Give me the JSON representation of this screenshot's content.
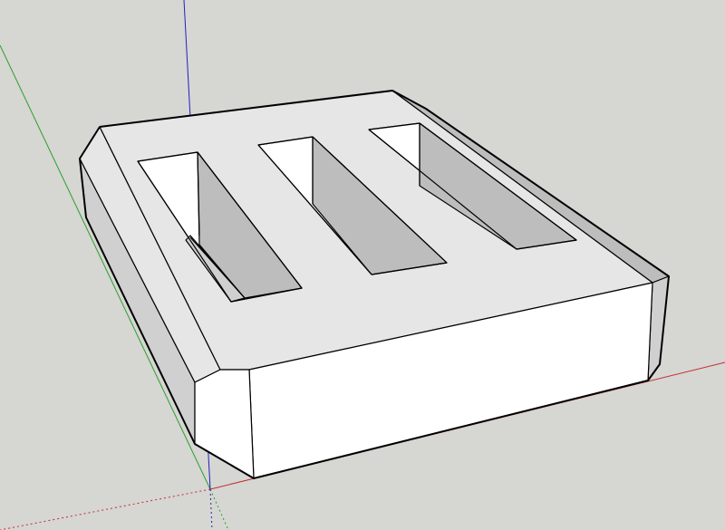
{
  "app": {
    "tool": "3d-modeling-viewport"
  },
  "scene": {
    "background_color": "#d6d6d3",
    "axes": {
      "x_axis_color": "#c03030",
      "y_axis_color": "#2aa02a",
      "z_axis_color": "#2020c0"
    },
    "model": {
      "description_icon": "box-with-three-slots",
      "face_colors": {
        "top": "#e6e6e6",
        "front": "#ffffff",
        "left_side": "#d0d0d0",
        "slot_walls_dark": "#bdbdbd",
        "slot_walls_light": "#ffffff",
        "edge": "#000000"
      }
    }
  }
}
